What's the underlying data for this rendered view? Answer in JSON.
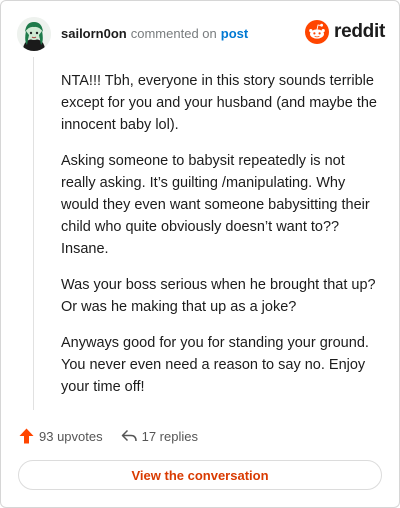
{
  "header": {
    "username": "sailorn0on",
    "commented_text": "commented on",
    "post_link": "post",
    "brand": "reddit",
    "brand_color": "#ff4500"
  },
  "comment": {
    "paragraphs": [
      "NTA!!! Tbh, everyone in this story sounds terrible except for you and your husband (and maybe the innocent baby lol).",
      "Asking someone to babysit repeatedly is not really asking. It’s guilting /manipulating. Why would they even want someone babysitting their child who quite obviously doesn’t want to?? Insane.",
      "Was your boss serious when he brought that up? Or was he making that up as a joke?",
      "Anyways good for you for standing your ground. You never even need a reason to say no. Enjoy your time off!"
    ]
  },
  "actions": {
    "upvotes": "93 upvotes",
    "upvote_icon": "upvote-arrow-icon",
    "replies": "17 replies",
    "reply_icon": "reply-arrow-icon"
  },
  "cta": {
    "label": "View the conversation",
    "color": "#d93a00"
  }
}
